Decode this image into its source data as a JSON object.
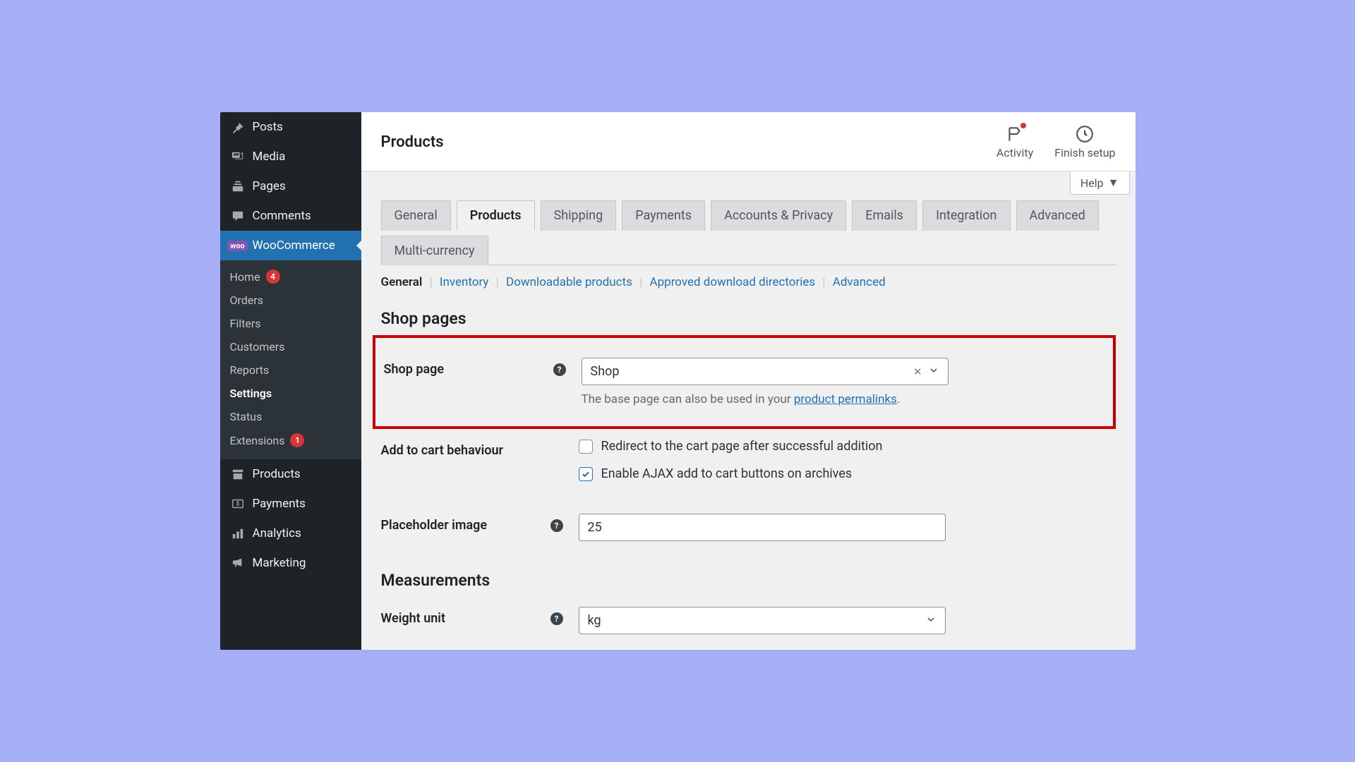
{
  "header": {
    "title": "Products",
    "activity_label": "Activity",
    "finish_setup_label": "Finish setup",
    "help_label": "Help"
  },
  "sidebar": {
    "posts": "Posts",
    "media": "Media",
    "pages": "Pages",
    "comments": "Comments",
    "woocommerce": "WooCommerce",
    "woo_badge": "woo",
    "home": "Home",
    "home_count": "4",
    "orders": "Orders",
    "filters": "Filters",
    "customers": "Customers",
    "reports": "Reports",
    "settings": "Settings",
    "status": "Status",
    "extensions": "Extensions",
    "extensions_count": "1",
    "products": "Products",
    "payments": "Payments",
    "analytics": "Analytics",
    "marketing": "Marketing"
  },
  "tabs": {
    "general": "General",
    "products": "Products",
    "shipping": "Shipping",
    "payments": "Payments",
    "accounts_privacy": "Accounts & Privacy",
    "emails": "Emails",
    "integration": "Integration",
    "advanced": "Advanced",
    "multi_currency": "Multi-currency"
  },
  "subsections": {
    "general": "General",
    "inventory": "Inventory",
    "downloadable": "Downloadable products",
    "approved_dirs": "Approved download directories",
    "advanced": "Advanced"
  },
  "sections": {
    "shop_pages_title": "Shop pages",
    "shop_page_label": "Shop page",
    "shop_page_value": "Shop",
    "shop_page_hint_prefix": "The base page can also be used in your ",
    "shop_page_hint_link": "product permalinks",
    "shop_page_hint_suffix": ".",
    "add_to_cart_label": "Add to cart behaviour",
    "redirect_label": "Redirect to the cart page after successful addition",
    "ajax_label": "Enable AJAX add to cart buttons on archives",
    "placeholder_image_label": "Placeholder image",
    "placeholder_image_value": "25",
    "measurements_title": "Measurements",
    "weight_unit_label": "Weight unit",
    "weight_unit_value": "kg"
  }
}
